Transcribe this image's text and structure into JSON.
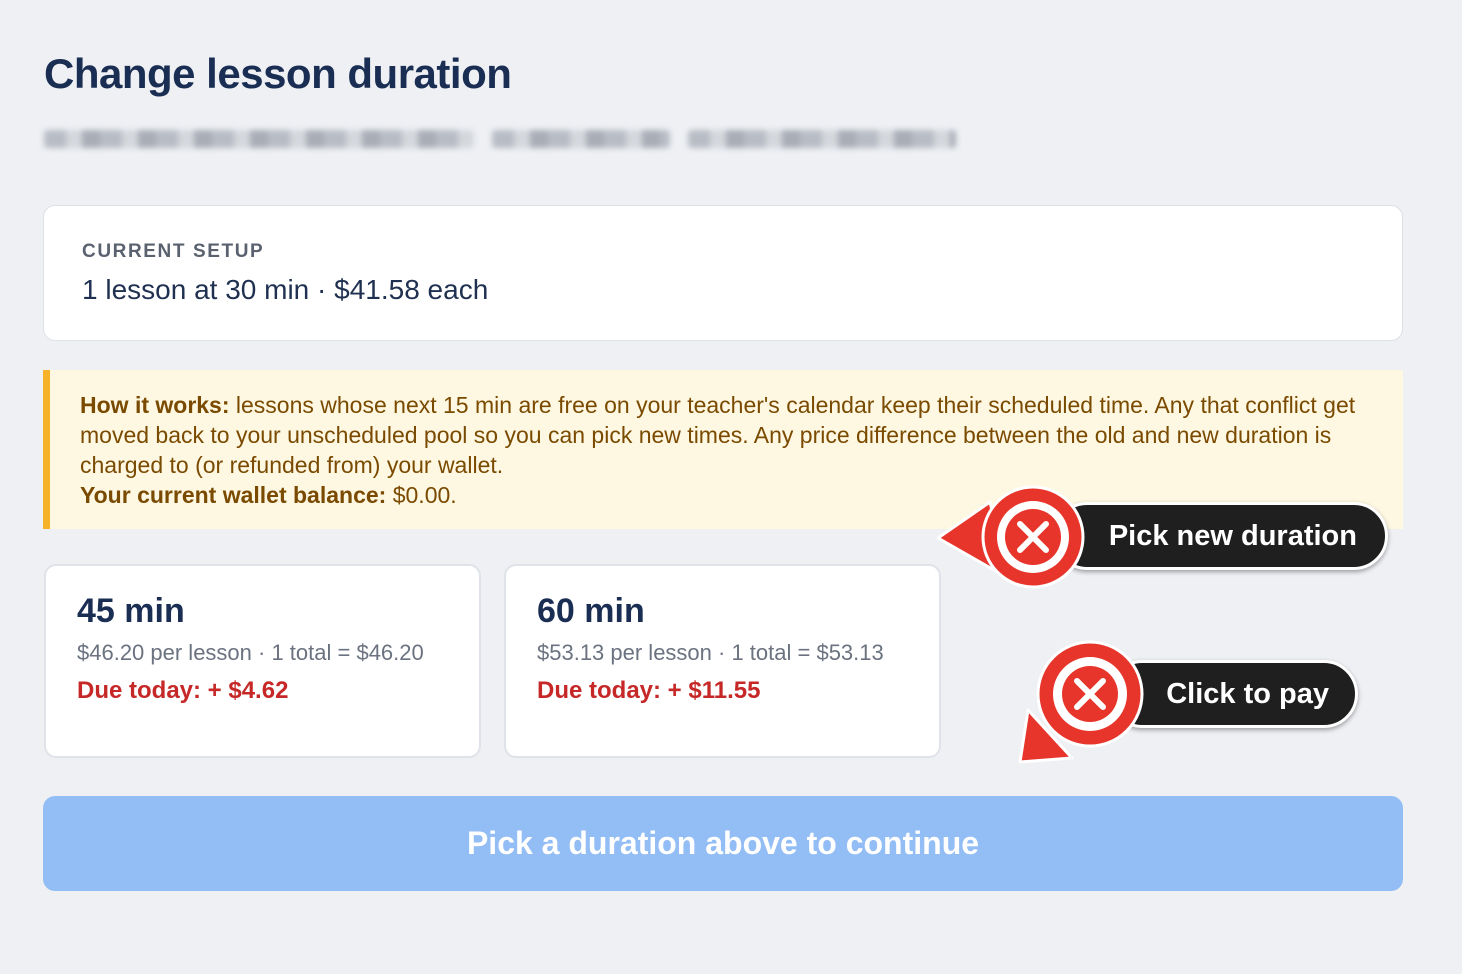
{
  "page": {
    "title": "Change lesson duration"
  },
  "current_setup": {
    "label": "CURRENT SETUP",
    "value": "1 lesson at 30 min · $41.58 each"
  },
  "notice": {
    "heading": "How it works:",
    "body": " lessons whose next 15 min are free on your teacher's calendar keep their scheduled time. Any that conflict get moved back to your unscheduled pool so you can pick new times. Any price difference between the old and new duration is charged to (or refunded from) your wallet.",
    "balance_label": "Your current wallet balance:",
    "balance_value": " $0.00."
  },
  "options": [
    {
      "title": "45 min",
      "price": "$46.20 per lesson · 1 total = $46.20",
      "due": "Due today: + $4.62"
    },
    {
      "title": "60 min",
      "price": "$53.13 per lesson · 1 total = $53.13",
      "due": "Due today: + $11.55"
    }
  ],
  "continue_button": {
    "label": "Pick a duration above to continue"
  },
  "annotations": [
    {
      "label": "Pick new duration",
      "icon": "close-icon"
    },
    {
      "label": "Click to pay",
      "icon": "close-icon"
    }
  ],
  "colors": {
    "title": "#1a2d52",
    "notice_accent": "#f6b228",
    "due": "#c62828",
    "button": "#93bdf5",
    "marker_red": "#e8352b"
  }
}
